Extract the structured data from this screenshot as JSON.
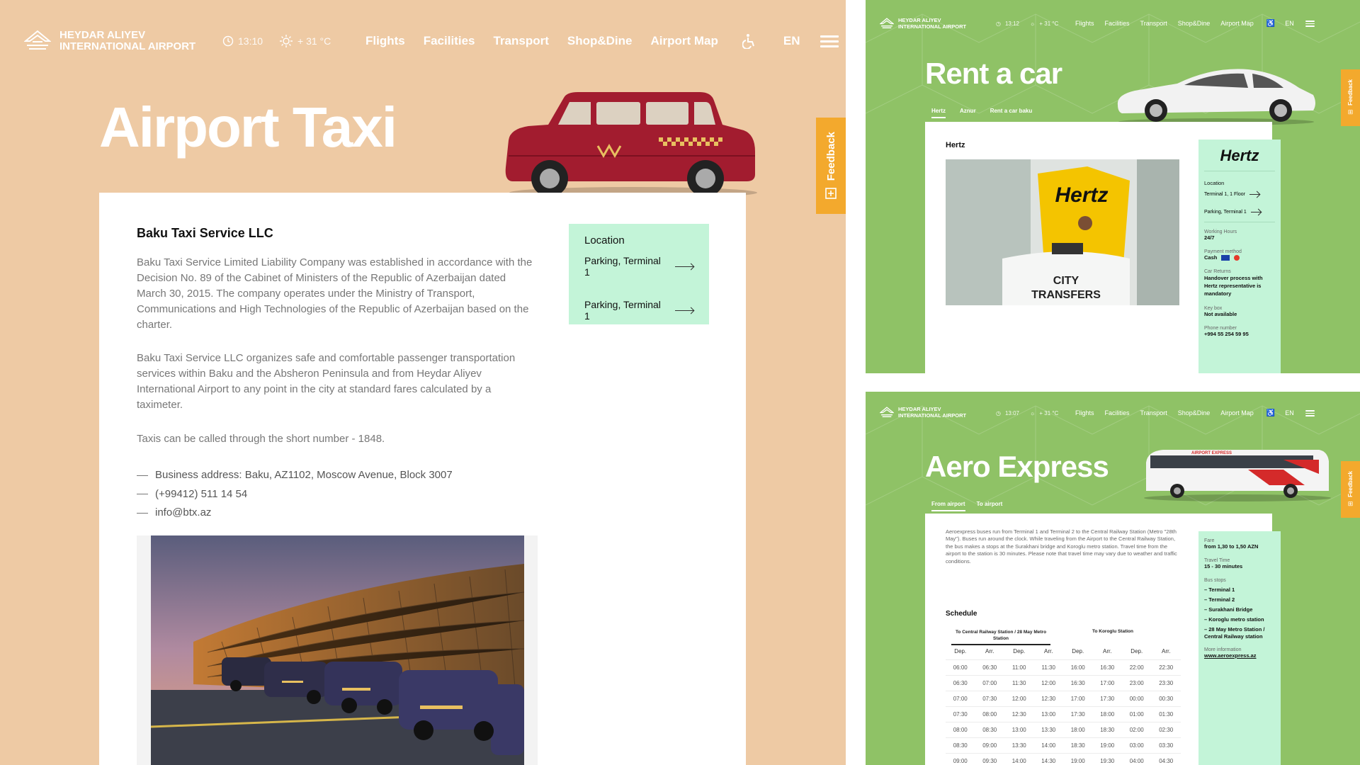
{
  "colors": {
    "taxi_bg": "#eecaa4",
    "green_bg": "#8fc266",
    "feedback": "#f3a92d",
    "location_bg": "#c3f4d8"
  },
  "taxi": {
    "logo": {
      "line1": "HEYDAR ALIYEV",
      "line2": "INTERNATIONAL AIRPORT",
      "icon": "airport-logo-icon"
    },
    "time": "13:10",
    "weather": "+ 31 °C",
    "nav": [
      "Flights",
      "Facilities",
      "Transport",
      "Shop&Dine",
      "Airport Map"
    ],
    "lang": "EN",
    "title": "Airport Taxi",
    "feedback": "Feedback",
    "company": "Baku Taxi Service LLC",
    "paragraphs": [
      "Baku Taxi Service Limited Liability Company was established in accordance with the Decision No. 89 of the Cabinet of Ministers of the Republic of Azerbaijan dated March 30, 2015. The company operates under the Ministry of Transport, Communications and High Technologies of the Republic of Azerbaijan based on the charter.",
      "Baku Taxi Service LLC organizes safe and comfortable passenger transportation services within Baku and the Absheron Peninsula and from Heydar Aliyev International Airport to any point in the city at standard fares calculated by a taximeter.",
      "Taxis can be called through the short number - 1848."
    ],
    "contacts": [
      "Business address: Baku, AZ1102, Moscow Avenue, Block 3007",
      "(+99412) 511 14 54",
      "info@btx.az"
    ],
    "location": {
      "title": "Location",
      "items": [
        "Parking, Terminal 1",
        "Parking, Terminal 1"
      ]
    }
  },
  "rent": {
    "logo": {
      "line1": "HEYDAR ALIYEV",
      "line2": "INTERNATIONAL AIRPORT"
    },
    "time": "13:12",
    "weather": "+ 31 °C",
    "nav": [
      "Flights",
      "Facilities",
      "Transport",
      "Shop&Dine",
      "Airport Map"
    ],
    "lang": "EN",
    "title": "Rent a car",
    "tabs": [
      "Hertz",
      "Aznur",
      "Rent a car baku"
    ],
    "feedback": "Feedback",
    "company": "Hertz",
    "photo_text": {
      "brand": "Hertz",
      "sign1": "CITY",
      "sign2": "TRANSFERS"
    },
    "side": {
      "brand": "Hertz",
      "location_title": "Location",
      "locations": [
        "Terminal 1, 1 Floor",
        "Parking, Terminal 1"
      ],
      "fields": [
        {
          "label": "Working Hours",
          "value": "24/7"
        },
        {
          "label": "Payment method",
          "value": "Cash"
        },
        {
          "label": "Car Returns",
          "value": "Handover process with Hertz representative is mandatory"
        },
        {
          "label": "Key box",
          "value": "Not available"
        },
        {
          "label": "Phone number",
          "value": "+994 55 254 59 95"
        }
      ]
    }
  },
  "aero": {
    "logo": {
      "line1": "HEYDAR ALIYEV",
      "line2": "INTERNATIONAL AIRPORT"
    },
    "time": "13:07",
    "weather": "+ 31 °C",
    "nav": [
      "Flights",
      "Facilities",
      "Transport",
      "Shop&Dine",
      "Airport Map"
    ],
    "lang": "EN",
    "title": "Aero Express",
    "tabs": [
      "From airport",
      "To airport"
    ],
    "feedback": "Feedback",
    "intro": "Aeroexpress buses run from Terminal 1 and Terminal 2 to the Central Railway Station (Metro \"28th May\"). Buses run around the clock. While traveling from the Airport to the Central Railway Station, the bus makes a stops at the Surakhani bridge and Koroglu metro station. Travel time from the airport to the station is 30 minutes. Please note that travel time may vary due to weather and traffic conditions.",
    "schedule_title": "Schedule",
    "route1": "To Central Railway Station / 28 May Metro Station",
    "route2": "To Koroglu Station",
    "cols": [
      "Dep.",
      "Arr.",
      "Dep.",
      "Arr.",
      "Dep.",
      "Arr.",
      "Dep.",
      "Arr."
    ],
    "rows": [
      [
        "06:00",
        "06:30",
        "11:00",
        "11:30",
        "16:00",
        "16:30",
        "22:00",
        "22:30"
      ],
      [
        "06:30",
        "07:00",
        "11:30",
        "12:00",
        "16:30",
        "17:00",
        "23:00",
        "23:30"
      ],
      [
        "07:00",
        "07:30",
        "12:00",
        "12:30",
        "17:00",
        "17:30",
        "00:00",
        "00:30"
      ],
      [
        "07:30",
        "08:00",
        "12:30",
        "13:00",
        "17:30",
        "18:00",
        "01:00",
        "01:30"
      ],
      [
        "08:00",
        "08:30",
        "13:00",
        "13:30",
        "18:00",
        "18:30",
        "02:00",
        "02:30"
      ],
      [
        "08:30",
        "09:00",
        "13:30",
        "14:00",
        "18:30",
        "19:00",
        "03:00",
        "03:30"
      ],
      [
        "09:00",
        "09:30",
        "14:00",
        "14:30",
        "19:00",
        "19:30",
        "04:00",
        "04:30"
      ]
    ],
    "side": [
      {
        "label": "Fare",
        "value": "from 1,30 to 1,50 AZN"
      },
      {
        "label": "Travel Time",
        "value": "15 - 30 minutes"
      }
    ],
    "stops_label": "Bus stops",
    "stops": [
      "Terminal 1",
      "Terminal 2",
      "Surakhani Bridge",
      "Koroglu metro station",
      "28 May Metro Station / Central Railway station"
    ],
    "more_label": "More information",
    "more_link": "www.aeroexpress.az",
    "bus_text": "AIRPORT EXPRESS"
  }
}
